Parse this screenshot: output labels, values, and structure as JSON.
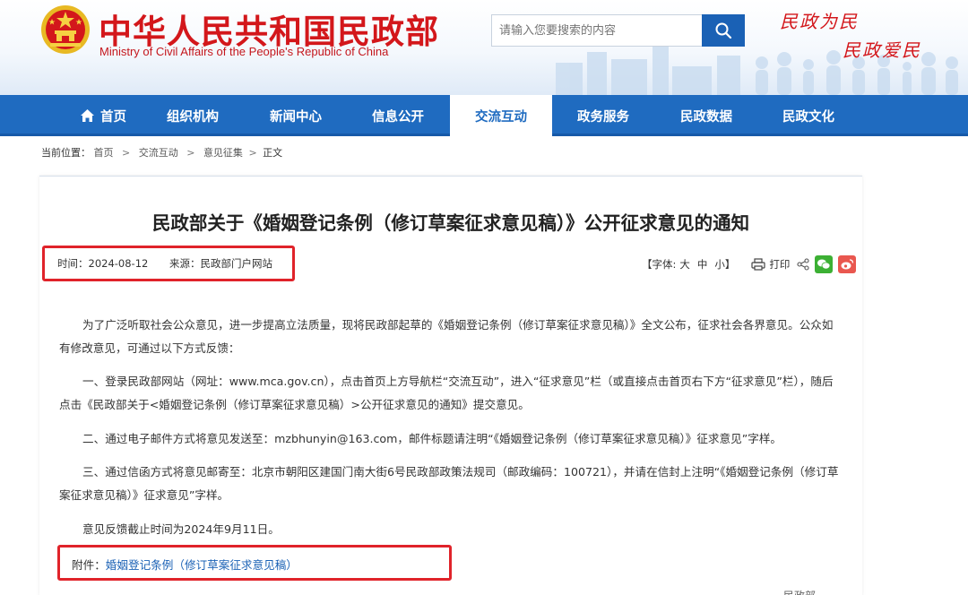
{
  "header": {
    "site_name_cn": "中华人民共和国民政部",
    "site_name_en": "Ministry of Civil Affairs of the People's Republic of China",
    "search_placeholder": "请输入您要搜索的内容",
    "slogan_line1": "民政为民",
    "slogan_line2": "民政爱民"
  },
  "nav": {
    "items": [
      {
        "label": "首页"
      },
      {
        "label": "组织机构"
      },
      {
        "label": "新闻中心"
      },
      {
        "label": "信息公开"
      },
      {
        "label": "交流互动"
      },
      {
        "label": "政务服务"
      },
      {
        "label": "民政数据"
      },
      {
        "label": "民政文化"
      }
    ],
    "active_label": "交流互动"
  },
  "breadcrumb": {
    "prefix": "当前位置：",
    "items": [
      "首页",
      "交流互动",
      "意见征集"
    ],
    "current": "正文"
  },
  "article": {
    "title": "民政部关于《婚姻登记条例（修订草案征求意见稿）》公开征求意见的通知",
    "time_label": "时间：",
    "time": "2024-08-12",
    "source_label": "来源：",
    "source": "民政部门户网站",
    "font_label": "【字体:",
    "font_large": "大",
    "font_medium": "中",
    "font_small": "小】",
    "print_label": "打印",
    "paragraphs": [
      "为了广泛听取社会公众意见，进一步提高立法质量，现将民政部起草的《婚姻登记条例（修订草案征求意见稿）》全文公布，征求社会各界意见。公众如有修改意见，可通过以下方式反馈：",
      "一、登录民政部网站（网址：www.mca.gov.cn），点击首页上方导航栏“交流互动”，进入“征求意见”栏（或直接点击首页右下方“征求意见”栏），随后点击《民政部关于<婚姻登记条例（修订草案征求意见稿）>公开征求意见的通知》提交意见。",
      "二、通过电子邮件方式将意见发送至：mzbhunyin@163.com，邮件标题请注明“《婚姻登记条例（修订草案征求意见稿）》征求意见”字样。",
      "三、通过信函方式将意见邮寄至：北京市朝阳区建国门南大街6号民政部政策法规司（邮政编码：100721），并请在信封上注明“《婚姻登记条例（修订草案征求意见稿）》征求意见”字样。",
      "意见反馈截止时间为2024年9月11日。"
    ],
    "attachment_label": "附件：",
    "attachment_link": "婚姻登记条例（修订草案征求意见稿）",
    "footer_partial": "民政部"
  },
  "colors": {
    "brand_red": "#d3171b",
    "nav_blue": "#1f6bc0",
    "highlight_red": "#e0232a",
    "wechat_green": "#3cb034",
    "weibo_red": "#e9574f"
  }
}
